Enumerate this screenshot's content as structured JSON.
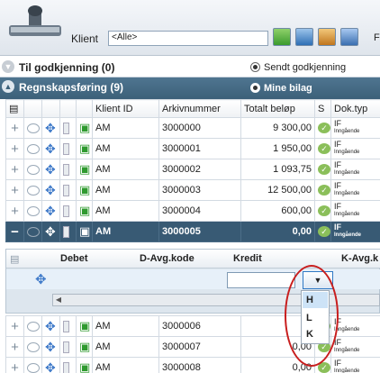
{
  "toolbar": {
    "klient_label": "Klient",
    "klient_value": "<Alle>",
    "extra_label": "F"
  },
  "sections": {
    "godkjenning_title": "Til godkjenning (0)",
    "sendt_label": "Sendt godkjenning",
    "regnskap_title": "Regnskapsføring (9)",
    "mine_label": "Mine bilag"
  },
  "columns": {
    "klient_id": "Klient ID",
    "arkivnummer": "Arkivnummer",
    "totalt": "Totalt beløp",
    "s": "S",
    "dok": "Dok.typ"
  },
  "rows": [
    {
      "klient": "AM",
      "arkiv": "3000000",
      "belop": "9 300,00",
      "dok": "IF",
      "dok2": "Inngående"
    },
    {
      "klient": "AM",
      "arkiv": "3000001",
      "belop": "1 950,00",
      "dok": "IF",
      "dok2": "Inngående"
    },
    {
      "klient": "AM",
      "arkiv": "3000002",
      "belop": "1 093,75",
      "dok": "IF",
      "dok2": "Inngående"
    },
    {
      "klient": "AM",
      "arkiv": "3000003",
      "belop": "12 500,00",
      "dok": "IF",
      "dok2": "Inngående"
    },
    {
      "klient": "AM",
      "arkiv": "3000004",
      "belop": "600,00",
      "dok": "IF",
      "dok2": "Inngående"
    }
  ],
  "selected": {
    "klient": "AM",
    "arkiv": "3000005",
    "belop": "0,00",
    "dok": "IF",
    "dok2": "Inngående"
  },
  "detail": {
    "debet": "Debet",
    "d_avg": "D-Avg.kode",
    "kredit": "Kredit",
    "k_avg": "K-Avg.k"
  },
  "dropdown_options": [
    "H",
    "L",
    "K"
  ],
  "rows_after": [
    {
      "klient": "AM",
      "arkiv": "3000006",
      "belop": "60",
      "dok": "IF",
      "dok2": "Inngående"
    },
    {
      "klient": "AM",
      "arkiv": "3000007",
      "belop": "0,00",
      "dok": "IF",
      "dok2": "Inngående"
    },
    {
      "klient": "AM",
      "arkiv": "3000008",
      "belop": "0,00",
      "dok": "IF",
      "dok2": "Inngående"
    }
  ],
  "colors": {
    "section_dark": "#3c6079",
    "selected_row": "#385a74",
    "highlight_ring": "#c81e1e",
    "dropdown_hover": "#cde3f7"
  }
}
